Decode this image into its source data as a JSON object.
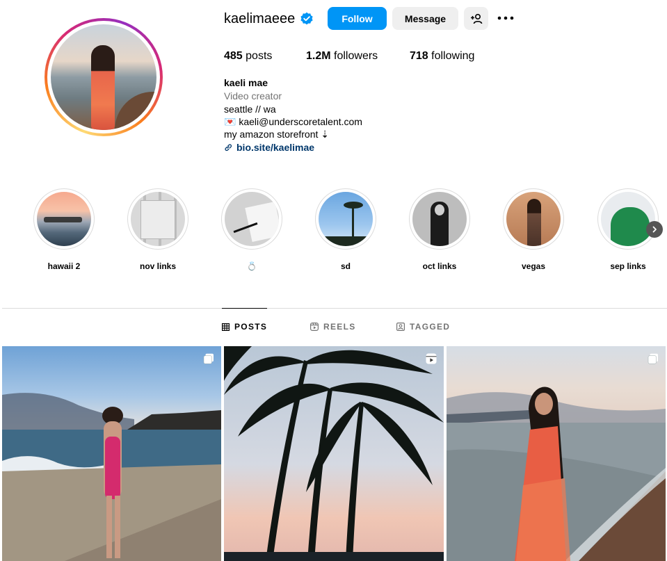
{
  "profile": {
    "username": "kaelimaeee",
    "verified": true,
    "buttons": {
      "follow": "Follow",
      "message": "Message"
    },
    "stats": {
      "posts_count": "485",
      "posts_label": "posts",
      "followers_count": "1.2M",
      "followers_label": "followers",
      "following_count": "718",
      "following_label": "following"
    },
    "bio": {
      "name": "kaeli mae",
      "category": "Video creator",
      "location": "seattle // wa",
      "email_emoji": "💌",
      "email": "kaeli@underscoretalent.com",
      "storefront": "my amazon storefront ⇣",
      "link": "bio.site/kaelimae"
    }
  },
  "highlights": [
    {
      "label": "hawaii 2"
    },
    {
      "label": "nov links"
    },
    {
      "label": "💍"
    },
    {
      "label": "sd"
    },
    {
      "label": "oct links"
    },
    {
      "label": "vegas"
    },
    {
      "label": "sep links"
    }
  ],
  "tabs": [
    {
      "label": "POSTS",
      "active": true
    },
    {
      "label": "REELS",
      "active": false
    },
    {
      "label": "TAGGED",
      "active": false
    }
  ],
  "posts": [
    {
      "type": "carousel",
      "icon": "carousel-icon"
    },
    {
      "type": "reel",
      "icon": "reel-icon"
    },
    {
      "type": "carousel",
      "icon": "carousel-icon"
    }
  ],
  "colors": {
    "accent": "#0095f6",
    "secondary_button": "#efefef",
    "link": "#00376b",
    "muted_text": "#737373",
    "divider": "#dbdbdb"
  }
}
